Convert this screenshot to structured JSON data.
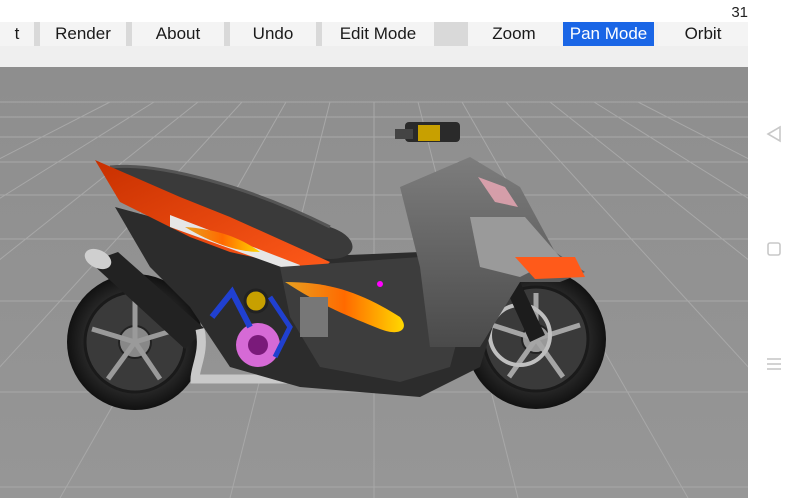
{
  "status_bar": {
    "time": "31"
  },
  "toolbar": {
    "items": [
      {
        "label": "t"
      },
      {
        "label": "Render"
      },
      {
        "label": "About"
      },
      {
        "label": "Undo"
      },
      {
        "label": "Edit Mode"
      },
      {
        "label": ""
      },
      {
        "label": "Zoom"
      },
      {
        "label": "Pan Mode"
      },
      {
        "label": "Orbit"
      }
    ],
    "active_item": "Pan Mode",
    "active_color": "#1a66e6"
  },
  "viewport": {
    "background": "#909090",
    "grid_color": "#a6a6a6",
    "model": "motor scooter"
  },
  "nav_bar": {
    "buttons": [
      {
        "icon": "back-triangle-icon"
      },
      {
        "icon": "home-square-icon"
      },
      {
        "icon": "recents-menu-icon"
      }
    ]
  }
}
